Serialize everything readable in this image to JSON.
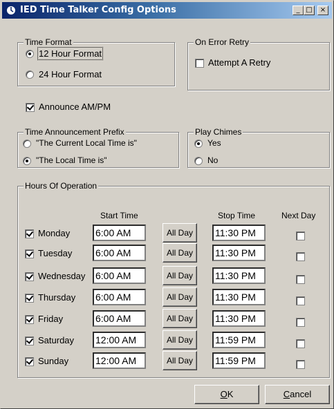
{
  "window": {
    "title": "IED Time Talker Config Options",
    "controls": {
      "minimize": "_",
      "maximize": "□",
      "close": "×"
    }
  },
  "time_format": {
    "legend": "Time Format",
    "options": [
      {
        "label": "12 Hour Format",
        "selected": true
      },
      {
        "label": "24 Hour Format",
        "selected": false
      }
    ]
  },
  "on_error_retry": {
    "legend": "On Error Retry",
    "attempt_label": "Attempt A Retry",
    "checked": false
  },
  "announce_ampm": {
    "label": "Announce AM/PM",
    "checked": true
  },
  "prefix": {
    "legend": "Time Announcement Prefix",
    "options": [
      {
        "label": "\"The Current Local Time is\"",
        "selected": false
      },
      {
        "label": "\"The Local Time is\"",
        "selected": true
      }
    ]
  },
  "chimes": {
    "legend": "Play Chimes",
    "options": [
      {
        "label": "Yes",
        "selected": true
      },
      {
        "label": "No",
        "selected": false
      }
    ]
  },
  "hours": {
    "legend": "Hours Of Operation",
    "headers": {
      "start": "Start Time",
      "stop": "Stop Time",
      "next_day": "Next Day"
    },
    "all_day_label": "All Day",
    "days": [
      {
        "day": "Monday",
        "enabled": true,
        "start": "6:00 AM",
        "stop": "11:30 PM",
        "next_day": false
      },
      {
        "day": "Tuesday",
        "enabled": true,
        "start": "6:00 AM",
        "stop": "11:30 PM",
        "next_day": false
      },
      {
        "day": "Wednesday",
        "enabled": true,
        "start": "6:00 AM",
        "stop": "11:30 PM",
        "next_day": false
      },
      {
        "day": "Thursday",
        "enabled": true,
        "start": "6:00 AM",
        "stop": "11:30 PM",
        "next_day": false
      },
      {
        "day": "Friday",
        "enabled": true,
        "start": "6:00 AM",
        "stop": "11:30 PM",
        "next_day": false
      },
      {
        "day": "Saturday",
        "enabled": true,
        "start": "12:00 AM",
        "stop": "11:59 PM",
        "next_day": false
      },
      {
        "day": "Sunday",
        "enabled": true,
        "start": "12:00 AM",
        "stop": "11:59 PM",
        "next_day": false
      }
    ]
  },
  "buttons": {
    "ok_rest": "K",
    "ok_hotkey": "O",
    "cancel_rest": "ancel",
    "cancel_hotkey": "C"
  }
}
